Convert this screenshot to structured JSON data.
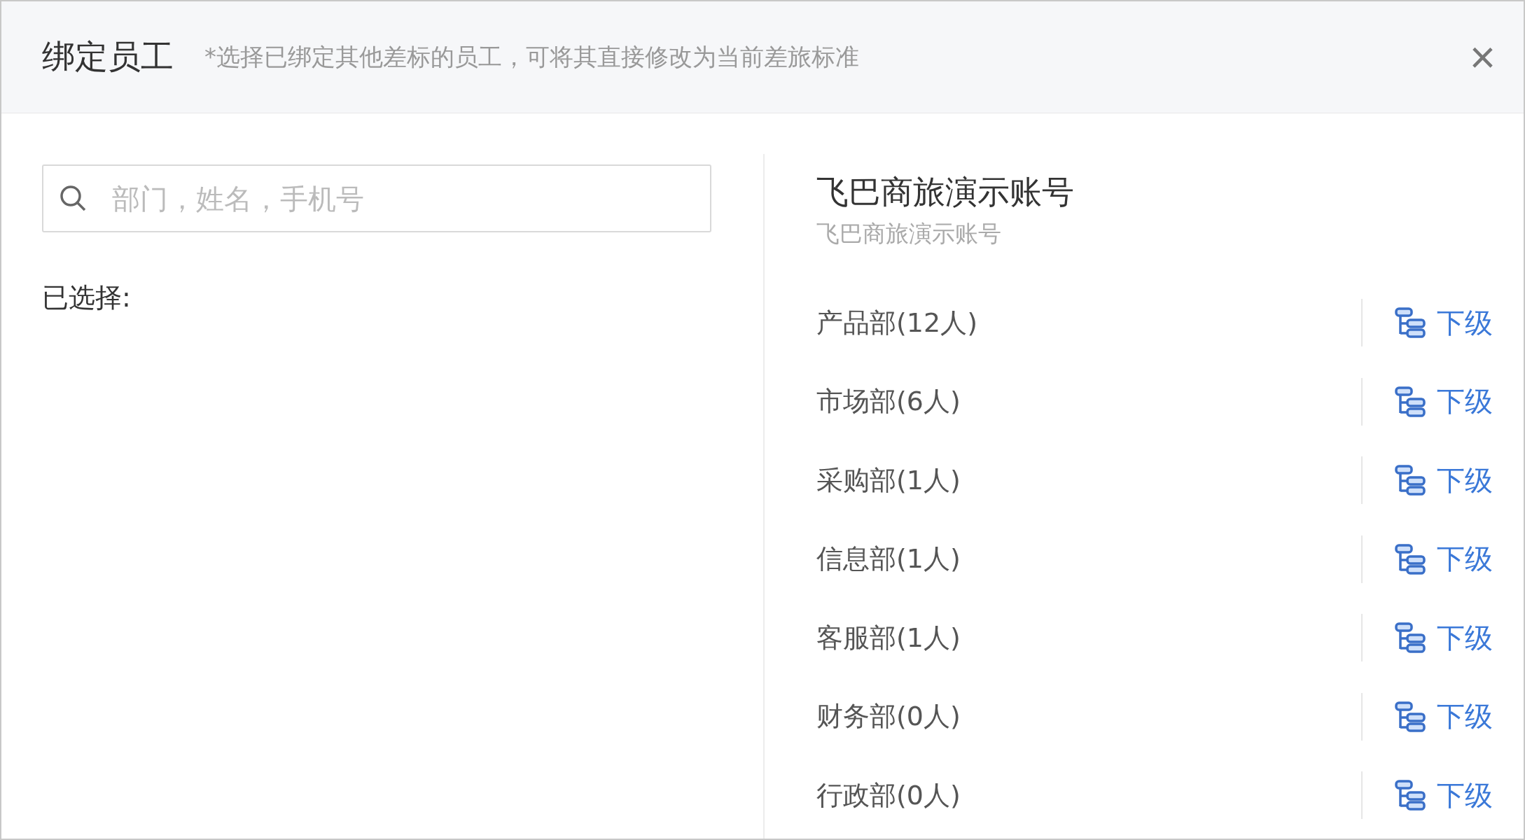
{
  "dialog": {
    "title": "绑定员工",
    "hint": "*选择已绑定其他差标的员工，可将其直接修改为当前差旅标准",
    "close": "×"
  },
  "search": {
    "placeholder": "部门，姓名，手机号"
  },
  "selected_label": "已选择:",
  "organization": {
    "name": "飞巴商旅演示账号",
    "subtitle": "飞巴商旅演示账号"
  },
  "departments": [
    {
      "name": "产品部(12人)",
      "action": "下级"
    },
    {
      "name": "市场部(6人)",
      "action": "下级"
    },
    {
      "name": "采购部(1人)",
      "action": "下级"
    },
    {
      "name": "信息部(1人)",
      "action": "下级"
    },
    {
      "name": "客服部(1人)",
      "action": "下级"
    },
    {
      "name": "财务部(0人)",
      "action": "下级"
    },
    {
      "name": "行政部(0人)",
      "action": "下级"
    }
  ]
}
